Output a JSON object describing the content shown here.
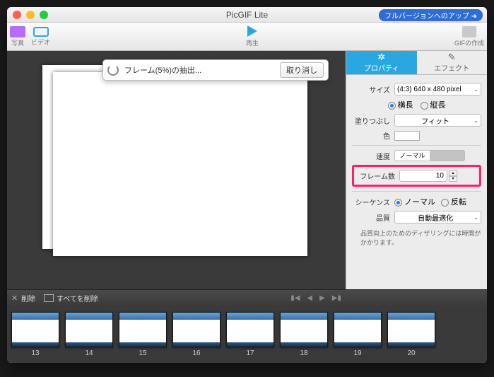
{
  "window": {
    "title": "PicGIF Lite",
    "upgrade_label": "フルバージョンへのアップ ➜"
  },
  "toolbar": {
    "photo": "写真",
    "video": "ビデオ",
    "play": "再生",
    "create": "GIFの作成"
  },
  "modal": {
    "text": "フレーム(5%)の抽出...",
    "cancel": "取り消し"
  },
  "tabs": {
    "properties": "プロパティ",
    "effects": "エフェクト"
  },
  "props": {
    "size_label": "サイズ",
    "size_value": "(4:3) 640 x 480 pixel",
    "landscape": "横長",
    "portrait": "縦長",
    "fill_label": "塗りつぶし",
    "fill_value": "フィット",
    "color_label": "色",
    "speed_label": "速度",
    "speed_normal": "ノーマル",
    "frames_label": "フレーム数",
    "frames_value": "10",
    "sequence_label": "シーケンス",
    "seq_normal": "ノーマル",
    "seq_reverse": "反転",
    "quality_label": "品質",
    "quality_value": "自動最適化",
    "quality_note": "品質向上のためのディザリングには時間がかかります。"
  },
  "timeline_bar": {
    "delete": "削除",
    "delete_all": "すべてを削除"
  },
  "frames": [
    {
      "n": "13"
    },
    {
      "n": "14"
    },
    {
      "n": "15"
    },
    {
      "n": "16"
    },
    {
      "n": "17"
    },
    {
      "n": "18"
    },
    {
      "n": "19"
    },
    {
      "n": "20"
    }
  ]
}
